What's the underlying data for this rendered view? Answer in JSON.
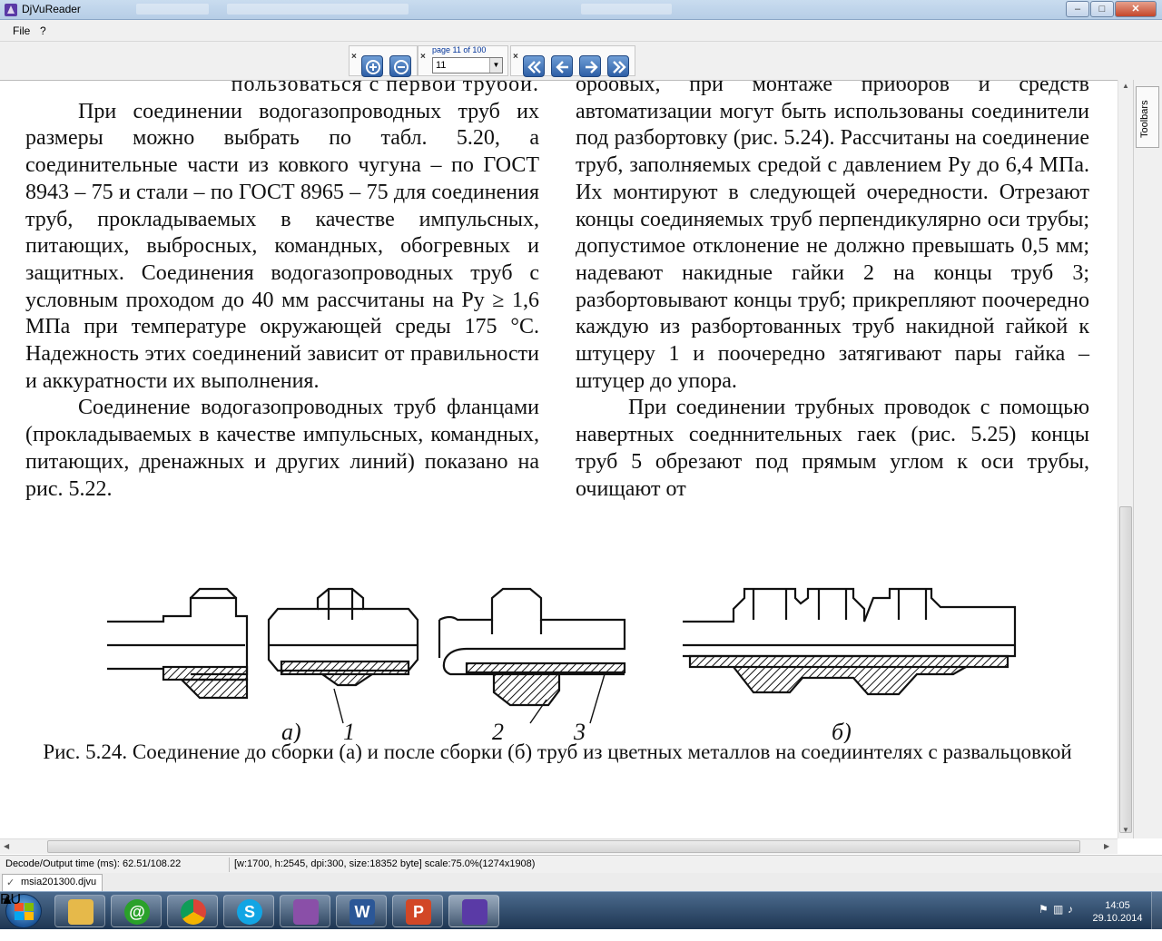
{
  "window": {
    "title": "DjVuReader",
    "min": "–",
    "max": "□",
    "close": "✕"
  },
  "menu": {
    "file": "File",
    "help": "?"
  },
  "toolbar": {
    "page_label": "page 11 of 100",
    "page_value": "11",
    "close_x": "×",
    "icons": [
      "zoom-in",
      "zoom-out",
      "first-page",
      "previous-page",
      "next-page",
      "last-page"
    ]
  },
  "document": {
    "left_column": [
      "пользоваться с первой трубой.",
      "При соединении водогазопроводных труб их размеры можно выбрать по табл. 5.20, а соединительные части из ковкого чугуна – по ГОСТ 8943 – 75 и стали – по ГОСТ 8965 – 75 для соединения труб, прокладываемых в качестве импульсных, питающих, выбросных, командных, обогревных и защитных. Соединения водогазопроводных труб с условным проходом до 40 мм рассчитаны на Pу ≥ 1,6 МПа при температуре окружающей среды 175 °С. Надежность этих соединений зависит от правильности и аккуратности их выполнения.",
      "Соединение водогазопроводных труб фланцами (прокладываемых в качестве импульсных, командных, питающих, дренажных и других линий) показано на рис. 5.22."
    ],
    "right_column": [
      "ороовых, при монтаже приборов и средств автоматизации могут быть использованы соединители под разбортовку (рис. 5.24). Рассчитаны на соединение труб, заполняемых средой с давлением Pу до 6,4 МПа. Их монтируют в следующей очередности. Отрезают концы соединяемых труб перпендикулярно оси трубы; допустимое отклонение не должно превышать 0,5 мм; надевают накидные гайки 2 на концы труб 3; разбортовывают концы труб; прикрепляют поочередно каждую из разбортованных труб накидной гайкой к штуцеру 1 и поочередно затягивают пары гайка – штуцер до упора.",
      "При соединении трубных проводок с помощью навертных соедннительных гаек (рис. 5.25) концы труб 5 обрезают под прямым углом к оси трубы, очищают от"
    ],
    "figure_labels": {
      "a": "а)",
      "n1": "1",
      "n2": "2",
      "n3": "3",
      "b": "б)"
    },
    "caption": "Рис. 5.24. Соединение до сборки (а) и после сборки (б) труб из цветных металлов на соедиинтелях с развальцовкой"
  },
  "sidebar": {
    "toolbars_label": "Toolbars"
  },
  "status": {
    "decode_time": "Decode/Output time (ms): 62.51/108.22",
    "page_info": "[w:1700, h:2545, dpi:300, size:18352 byte] scale:75.0%(1274x1908)"
  },
  "file_tab": {
    "name": "msia201300.djvu",
    "check": "✓"
  },
  "taskbar": {
    "apps": [
      "explorer",
      "mail-agent",
      "chrome",
      "skype",
      "winrar",
      "word",
      "powerpoint",
      "djvureader"
    ],
    "language": "RU",
    "tray_arrow": "▲",
    "time": "14:05",
    "date": "29.10.2014"
  },
  "colors": {
    "titlebar": "#c9dcef",
    "taskbar": "#1e3652",
    "toolbar_button": "#2d5fa6"
  }
}
